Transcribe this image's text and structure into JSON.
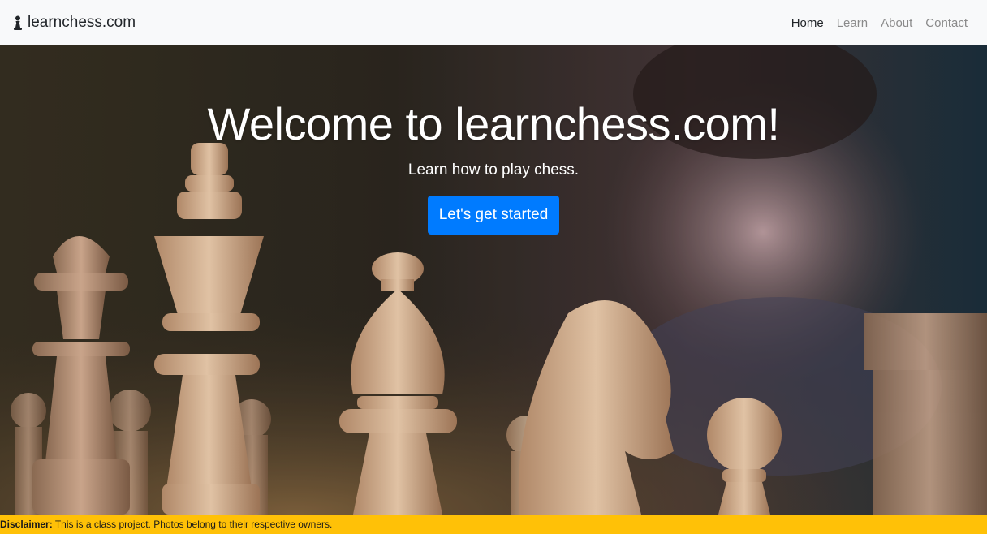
{
  "navbar": {
    "brand": "learnchess.com",
    "links": [
      {
        "label": "Home",
        "active": true
      },
      {
        "label": "Learn",
        "active": false
      },
      {
        "label": "About",
        "active": false
      },
      {
        "label": "Contact",
        "active": false
      }
    ]
  },
  "hero": {
    "title": "Welcome to learnchess.com!",
    "subtitle": "Learn how to play chess.",
    "cta_label": "Let's get started",
    "background_icon": "chess-photo"
  },
  "footer": {
    "disclaimer_label": "Disclaimer:",
    "disclaimer_text": " This is a class project. Photos belong to their respective owners."
  },
  "colors": {
    "navbar_bg": "#f8f9fa",
    "cta_bg": "#007bff",
    "disclaimer_bg": "#ffc107"
  }
}
